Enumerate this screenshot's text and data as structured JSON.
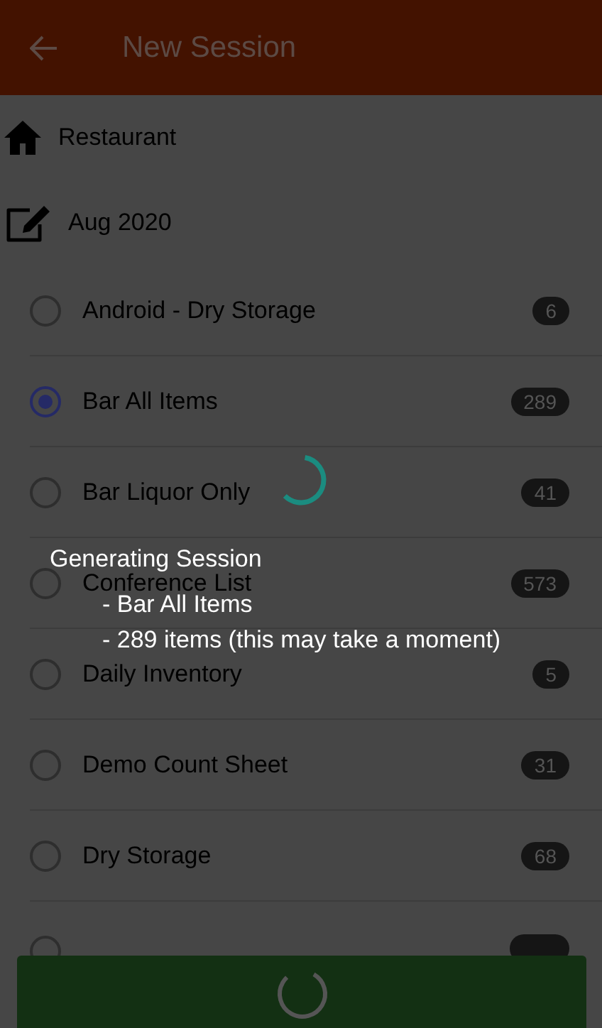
{
  "header": {
    "title": "New Session"
  },
  "location": "Restaurant",
  "period": "Aug 2020",
  "count_sheets": [
    {
      "name": "Android - Dry Storage",
      "count": "6",
      "selected": false
    },
    {
      "name": "Bar All Items",
      "count": "289",
      "selected": true
    },
    {
      "name": "Bar Liquor Only",
      "count": "41",
      "selected": false
    },
    {
      "name": "Conference List",
      "count": "573",
      "selected": false
    },
    {
      "name": "Daily Inventory",
      "count": "5",
      "selected": false
    },
    {
      "name": "Demo Count Sheet",
      "count": "31",
      "selected": false
    },
    {
      "name": "Dry Storage",
      "count": "68",
      "selected": false
    },
    {
      "selected": false
    }
  ],
  "progress_dialog": {
    "title": "Generating Session",
    "lines": [
      "- Bar All Items",
      "- 289 items (this may take a moment)"
    ]
  }
}
